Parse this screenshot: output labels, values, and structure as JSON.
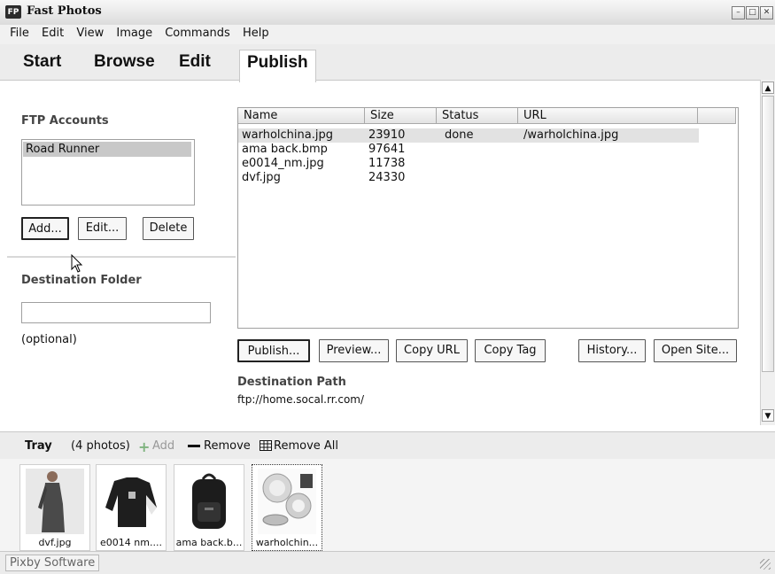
{
  "window": {
    "title": "Fast Photos",
    "logo_text": "FP"
  },
  "menu": [
    "File",
    "Edit",
    "View",
    "Image",
    "Commands",
    "Help"
  ],
  "modes": {
    "start": "Start",
    "browse": "Browse",
    "edit": "Edit",
    "publish": "Publish",
    "active": "Publish"
  },
  "ftp": {
    "label": "FTP Accounts",
    "accounts": [
      "Road Runner"
    ],
    "add_label": "Add...",
    "edit_label": "Edit...",
    "delete_label": "Delete"
  },
  "destination": {
    "label": "Destination Folder",
    "value": "",
    "hint": "(optional)"
  },
  "files": {
    "columns": [
      "Name",
      "Size",
      "Status",
      "URL"
    ],
    "rows": [
      {
        "name": "warholchina.jpg",
        "size": "23910",
        "status": "done",
        "url": "/warholchina.jpg"
      },
      {
        "name": "ama back.bmp",
        "size": "97641",
        "status": "",
        "url": ""
      },
      {
        "name": "e0014_nm.jpg",
        "size": "11738",
        "status": "",
        "url": ""
      },
      {
        "name": "dvf.jpg",
        "size": "24330",
        "status": "",
        "url": ""
      }
    ]
  },
  "actions": {
    "publish": "Publish...",
    "preview": "Preview...",
    "copy_url": "Copy URL",
    "copy_tag": "Copy Tag",
    "history": "History...",
    "open_site": "Open Site..."
  },
  "dest_path": {
    "label": "Destination Path",
    "value": "ftp://home.socal.rr.com/"
  },
  "tray": {
    "label": "Tray",
    "count": "(4 photos)",
    "add": "Add",
    "remove": "Remove",
    "remove_all": "Remove All",
    "photos": [
      {
        "caption": "dvf.jpg",
        "icon": "coat-photo"
      },
      {
        "caption": "e0014 nm....",
        "icon": "jacket-photo"
      },
      {
        "caption": "ama back.b...",
        "icon": "backpack-photo"
      },
      {
        "caption": "warholchin...",
        "icon": "dishes-photo"
      }
    ]
  },
  "status": {
    "text": "Pixby Software"
  },
  "colors": {
    "accent_add": "#4caf50",
    "selection": "#c8c8c8"
  }
}
